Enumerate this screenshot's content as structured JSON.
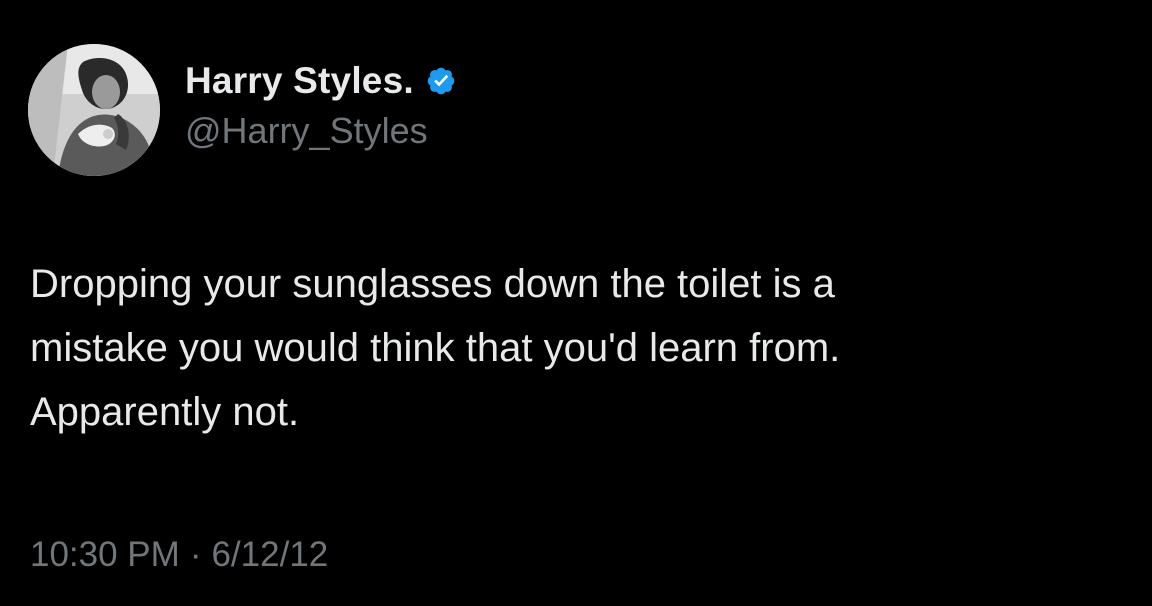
{
  "author": {
    "display_name": "Harry Styles.",
    "handle": "@Harry_Styles",
    "verified": true,
    "verified_color": "#1d9bf0"
  },
  "tweet": {
    "lines": [
      "Dropping your sunglasses down the toilet is a",
      "mistake you would think that you'd learn from.",
      "Apparently not."
    ],
    "time": "10:30 PM",
    "separator": "·",
    "date": "6/12/12"
  },
  "theme": {
    "background": "#000000",
    "primary_text": "#e7e9ea",
    "secondary_text": "#71767b"
  },
  "icons": {
    "avatar": "profile-photo",
    "verified": "verified-badge-icon"
  }
}
